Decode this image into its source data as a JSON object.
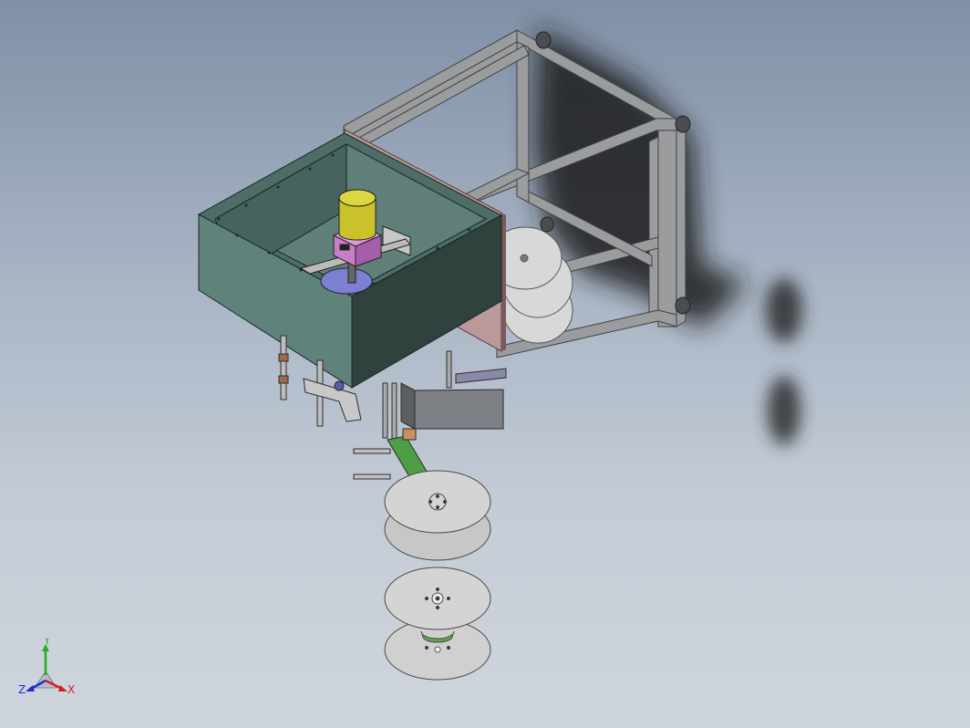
{
  "view": {
    "triad": {
      "x_label": "X",
      "y_label": "Y",
      "z_label": "Z",
      "x_color": "#d42020",
      "y_color": "#20b020",
      "z_color": "#2030d0"
    },
    "colors": {
      "frame": "#9a9c9e",
      "frame_dark": "#6e7173",
      "housing_front": "#2f423d",
      "housing_side": "#5f837b",
      "housing_top": "#4d6d66",
      "pink_panel": "#b99999",
      "motor_yellow": "#c9c22a",
      "motor_purple": "#c67ec9",
      "disc": "#cfcfcf",
      "green_part": "#4e9e46",
      "shadow": "#2a2a2a"
    }
  }
}
